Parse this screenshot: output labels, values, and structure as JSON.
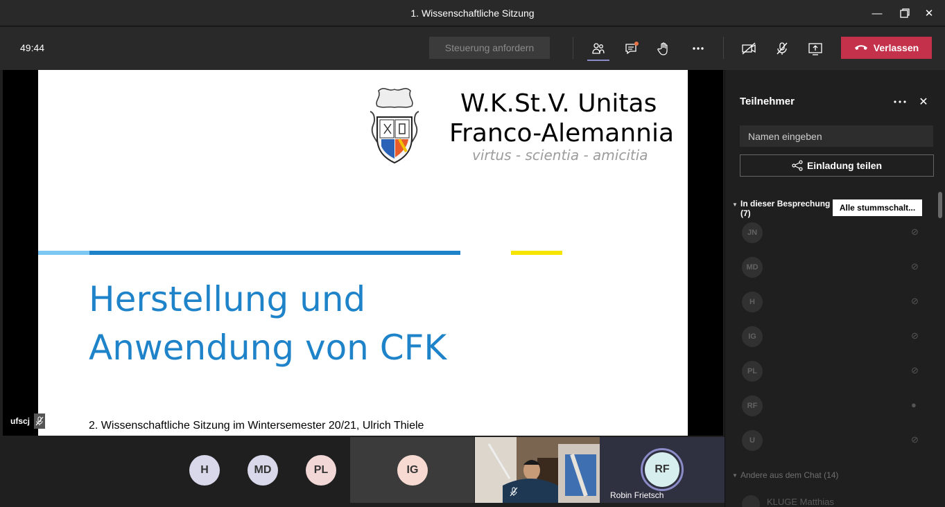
{
  "window": {
    "title": "1. Wissenschaftliche Sitzung"
  },
  "toolbar": {
    "timer": "49:44",
    "control_request_label": "Steuerung anfordern",
    "leave_label": "Verlassen"
  },
  "slide": {
    "org_line1": "W.K.St.V. Unitas",
    "org_line2": "Franco-Alemannia",
    "motto": "virtus - scientia - amicitia",
    "title_line1": "Herstellung und",
    "title_line2": "Anwendung von CFK",
    "subtitle": "2. Wissenschaftliche Sitzung im Wintersemester 20/21, Ulrich Thiele",
    "bar_colors": [
      "#7cc8f2",
      "#1e83c9",
      "#f5e500"
    ]
  },
  "self_view": {
    "label": "ufscj"
  },
  "strip": {
    "avatars": [
      {
        "initials": "H",
        "color": "#d8d8ea"
      },
      {
        "initials": "MD",
        "color": "#d8d8ea"
      },
      {
        "initials": "PL",
        "color": "#f2d7d7"
      }
    ],
    "ig_tile": {
      "initials": "IG",
      "color": "#f7dbd3"
    },
    "rf_tile": {
      "initials": "RF",
      "name": "Robin Frietsch",
      "color": "#d7eeef",
      "ring_color": "#8b8cc7"
    }
  },
  "panel": {
    "title": "Teilnehmer",
    "search_placeholder": "Namen eingeben",
    "invite_label": "Einladung teilen",
    "section_label_line1": "In dieser Besprechung",
    "section_label_line2": "(7)",
    "mute_all_label": "Alle stummschalt...",
    "participants": [
      {
        "initials": "JN"
      },
      {
        "initials": "MD"
      },
      {
        "initials": "H"
      },
      {
        "initials": "IG"
      },
      {
        "initials": "PL"
      },
      {
        "initials": "RF"
      },
      {
        "initials": "U"
      }
    ],
    "chat_section_label": "Andere aus dem Chat (14)",
    "chat_first": "KLUGE Matthias"
  }
}
